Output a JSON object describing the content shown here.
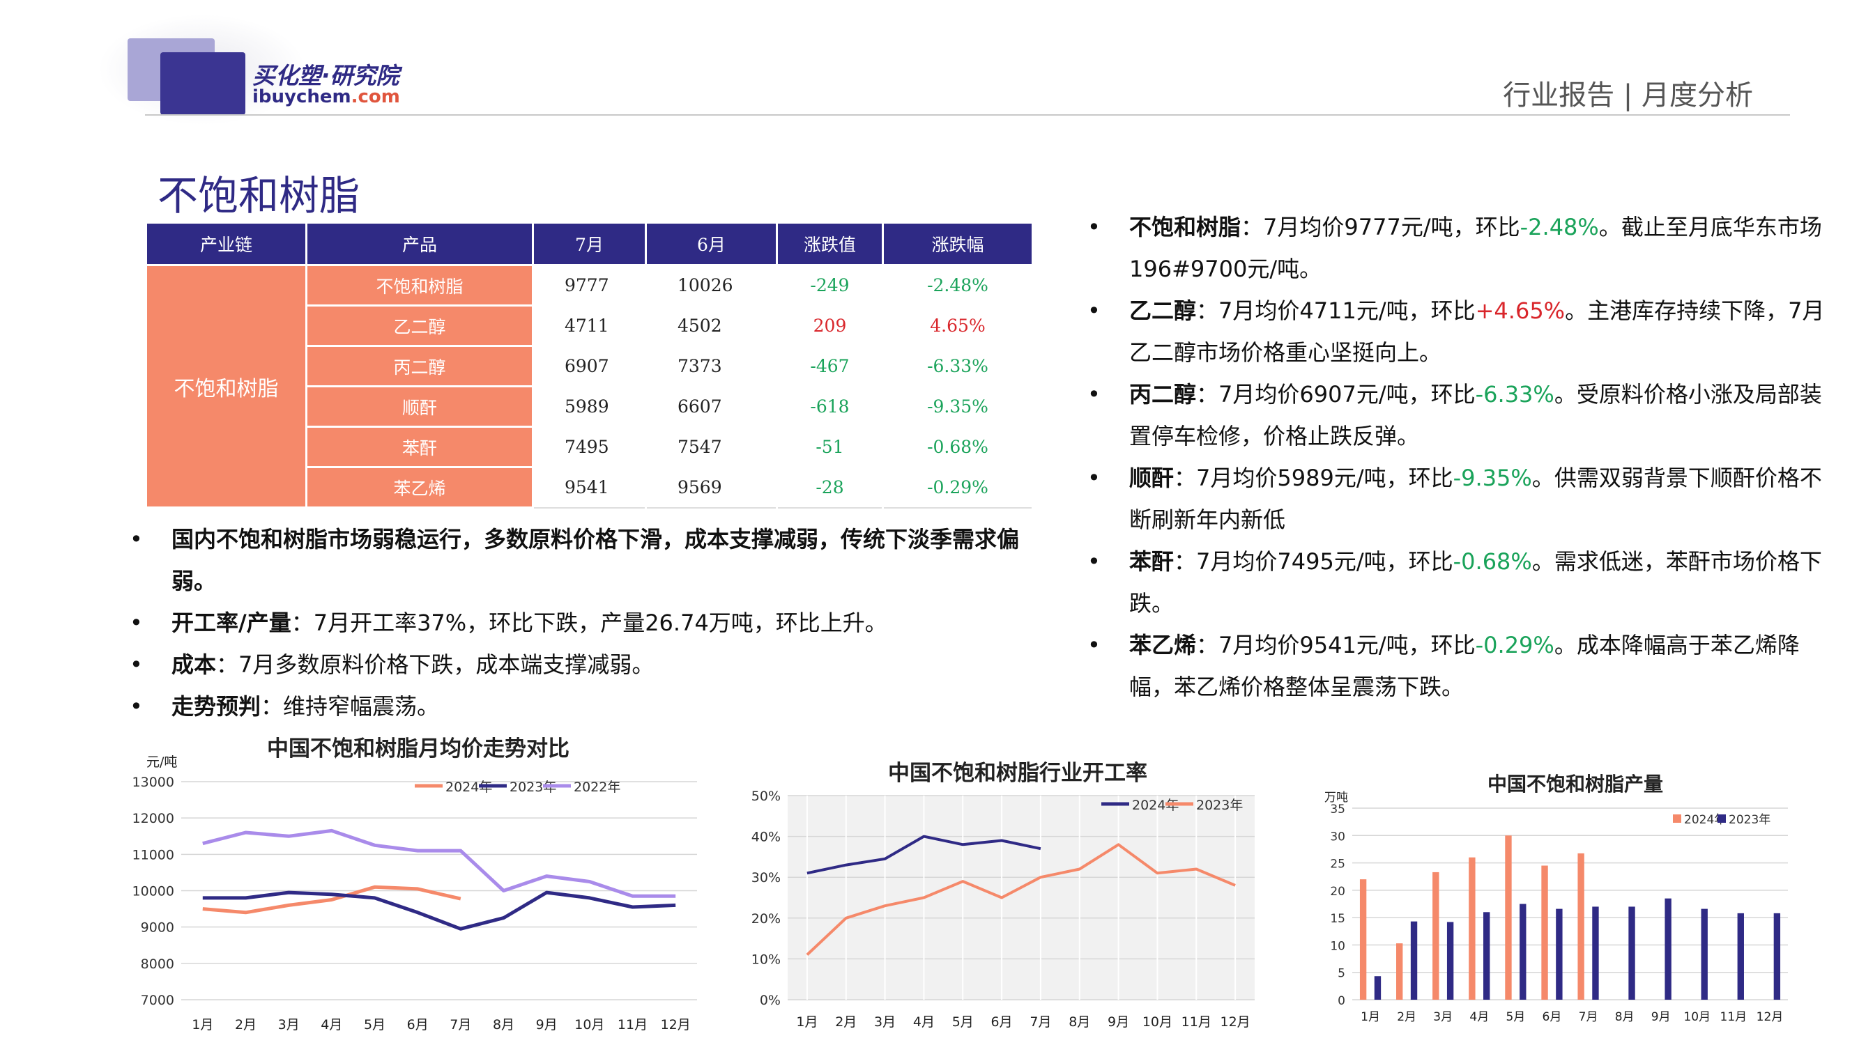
{
  "header": {
    "logo_cn": "买化塑·研究院",
    "logo_en_main": "ibuychem",
    "logo_en_tld": ".com",
    "report_label": "行业报告 | 月度分析"
  },
  "page_title": "不饱和树脂",
  "table": {
    "headers": [
      "产业链",
      "产品",
      "7月",
      "6月",
      "涨跌值",
      "涨跌幅"
    ],
    "chain": "不饱和树脂",
    "rows": [
      {
        "product": "不饱和树脂",
        "jul": "9777",
        "jun": "10026",
        "diff": "-249",
        "pct": "-2.48%"
      },
      {
        "product": "乙二醇",
        "jul": "4711",
        "jun": "4502",
        "diff": "209",
        "pct": "4.65%"
      },
      {
        "product": "丙二醇",
        "jul": "6907",
        "jun": "7373",
        "diff": "-467",
        "pct": "-6.33%"
      },
      {
        "product": "顺酐",
        "jul": "5989",
        "jun": "6607",
        "diff": "-618",
        "pct": "-9.35%"
      },
      {
        "product": "苯酐",
        "jul": "7495",
        "jun": "7547",
        "diff": "-51",
        "pct": "-0.68%"
      },
      {
        "product": "苯乙烯",
        "jul": "9541",
        "jun": "9569",
        "diff": "-28",
        "pct": "-0.29%"
      }
    ]
  },
  "left_bullets": [
    {
      "bold": "国内不饱和树脂市场弱稳运行，多数原料价格下滑，成本支撑减弱，传统下淡季需求偏弱。",
      "text": ""
    },
    {
      "bold": "开工率/产量",
      "text": "：7月开工率37%，环比下跌，产量26.74万吨，环比上升。"
    },
    {
      "bold": "成本",
      "text": "：7月多数原料价格下跌，成本端支撑减弱。"
    },
    {
      "bold": "走势预判",
      "text": "：维持窄幅震荡。"
    }
  ],
  "right_bullets": [
    {
      "bold": "不饱和树脂",
      "pre": "：7月均价9777元/吨，环比",
      "chg": "-2.48%",
      "dir": "down",
      "post": "。截止至月底华东市场196#9700元/吨。"
    },
    {
      "bold": "乙二醇",
      "pre": "：7月均价4711元/吨，环比",
      "chg": "+4.65%",
      "dir": "up",
      "post": "。主港库存持续下降，7月乙二醇市场价格重心坚挺向上。"
    },
    {
      "bold": "丙二醇",
      "pre": "：7月均价6907元/吨，环比",
      "chg": "-6.33%",
      "dir": "down",
      "post": "。受原料价格小涨及局部装置停车检修，价格止跌反弹。"
    },
    {
      "bold": "顺酐",
      "pre": "：7月均价5989元/吨，环比",
      "chg": "-9.35%",
      "dir": "down",
      "post": "。供需双弱背景下顺酐价格不断刷新年内新低"
    },
    {
      "bold": "苯酐",
      "pre": "：7月均价7495元/吨，环比",
      "chg": "-0.68%",
      "dir": "down",
      "post": "。需求低迷，苯酐市场价格下跌。"
    },
    {
      "bold": "苯乙烯",
      "pre": "：7月均价9541元/吨，环比",
      "chg": "-0.29%",
      "dir": "down",
      "post": "。成本降幅高于苯乙烯降幅，苯乙烯价格整体呈震荡下跌。"
    }
  ],
  "colors": {
    "navy": "#2f2a85",
    "orange": "#f5896a",
    "purple": "#a98bea",
    "green": "#1aa35a",
    "red": "#d9262b"
  },
  "chart_data": [
    {
      "type": "line",
      "title": "中国不饱和树脂月均价走势对比",
      "ylabel": "元/吨",
      "categories": [
        "1月",
        "2月",
        "3月",
        "4月",
        "5月",
        "6月",
        "7月",
        "8月",
        "9月",
        "10月",
        "11月",
        "12月"
      ],
      "ylim": [
        7000,
        13000
      ],
      "yticks": [
        7000,
        8000,
        9000,
        10000,
        11000,
        12000,
        13000
      ],
      "grid": true,
      "legend": "top-right",
      "series": [
        {
          "name": "2024年",
          "color": "#f5896a",
          "values": [
            9500,
            9400,
            9600,
            9750,
            10100,
            10050,
            9777,
            null,
            null,
            null,
            null,
            null
          ]
        },
        {
          "name": "2023年",
          "color": "#2f2a85",
          "values": [
            9800,
            9800,
            9950,
            9900,
            9800,
            9400,
            8950,
            9250,
            9950,
            9800,
            9550,
            9600
          ]
        },
        {
          "name": "2022年",
          "color": "#a98bea",
          "values": [
            11300,
            11600,
            11500,
            11650,
            11250,
            11100,
            11100,
            10000,
            10400,
            10250,
            9850,
            9850
          ]
        }
      ]
    },
    {
      "type": "line",
      "title": "中国不饱和树脂行业开工率",
      "categories": [
        "1月",
        "2月",
        "3月",
        "4月",
        "5月",
        "6月",
        "7月",
        "8月",
        "9月",
        "10月",
        "11月",
        "12月"
      ],
      "ylim": [
        0,
        50
      ],
      "yticks": [
        "0%",
        "10%",
        "20%",
        "30%",
        "40%",
        "50%"
      ],
      "ytick_values": [
        0,
        10,
        20,
        30,
        40,
        50
      ],
      "grid": true,
      "legend": "top-right",
      "series": [
        {
          "name": "2024年",
          "color": "#2f2a85",
          "values": [
            31,
            33,
            34.5,
            40,
            38,
            39,
            37,
            null,
            null,
            null,
            null,
            null
          ]
        },
        {
          "name": "2023年",
          "color": "#f5896a",
          "values": [
            11,
            20,
            23,
            25,
            29,
            25,
            30,
            32,
            38,
            31,
            32,
            28
          ]
        }
      ]
    },
    {
      "type": "bar",
      "title": "中国不饱和树脂产量",
      "ylabel": "万吨",
      "categories": [
        "1月",
        "2月",
        "3月",
        "4月",
        "5月",
        "6月",
        "7月",
        "8月",
        "9月",
        "10月",
        "11月",
        "12月"
      ],
      "ylim": [
        0,
        35
      ],
      "yticks": [
        0,
        5,
        10,
        15,
        20,
        25,
        30,
        35
      ],
      "grid": true,
      "legend": "top-right",
      "series": [
        {
          "name": "2024年",
          "color": "#f5896a",
          "values": [
            22,
            10.3,
            23.3,
            26,
            30,
            24.5,
            26.74,
            null,
            null,
            null,
            null,
            null
          ]
        },
        {
          "name": "2023年",
          "color": "#2f2a85",
          "values": [
            4.3,
            14.3,
            14.2,
            16,
            17.5,
            16.6,
            17,
            17,
            18.5,
            16.6,
            15.8,
            15.8
          ]
        }
      ]
    }
  ]
}
